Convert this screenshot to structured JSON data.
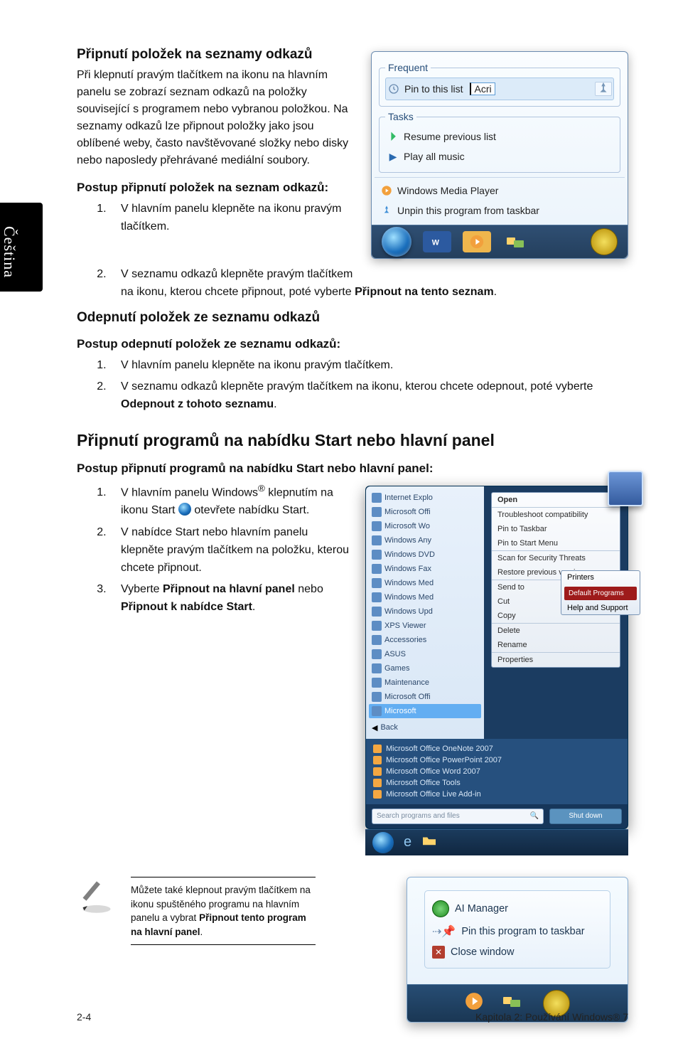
{
  "side_tab": "Čeština",
  "section1": {
    "title": "Připnutí položek na seznamy odkazů",
    "body": "Při klepnutí pravým tlačítkem na ikonu na hlavním panelu se zobrazí seznam odkazů na položky související s programem nebo vybranou položkou. Na seznamy odkazů lze připnout položky jako jsou oblíbené weby, často navštěvované složky nebo disky nebo naposledy přehrávané mediální soubory.",
    "sub": "Postup připnutí položek na seznam odkazů:",
    "steps": [
      "V hlavním panelu klepněte na ikonu pravým tlačítkem.",
      "V seznamu odkazů klepněte pravým tlačítkem na ikonu, kterou chcete připnout, poté vyberte <b>Připnout na tento seznam</b>."
    ]
  },
  "section2": {
    "title": "Odepnutí položek ze seznamu odkazů",
    "sub": "Postup odepnutí položek ze seznamu odkazů:",
    "steps": [
      "V hlavním panelu klepněte na ikonu pravým tlačítkem.",
      "V seznamu odkazů klepněte pravým tlačítkem na ikonu, kterou chcete odepnout, poté vyberte <b>Odepnout z tohoto seznamu</b>."
    ]
  },
  "section3": {
    "title": "Připnutí programů na nabídku Start nebo hlavní panel",
    "sub": "Postup připnutí programů na nabídku Start nebo hlavní panel:",
    "steps": [
      "V hlavním panelu Windows<sup>®</sup> klepnutím na ikonu Start __ORB__ otevřete nabídku Start.",
      "V nabídce Start nebo hlavním panelu klepněte pravým tlačítkem na položku, kterou chcete připnout.",
      "Vyberte <b>Připnout na hlavní panel</b> nebo <b>Připnout k nabídce Start</b>."
    ]
  },
  "note": "Můžete také klepnout pravým tlačítkem na ikonu spuštěného programu na hlavním panelu a vybrat <b>Připnout tento program na hlavní panel</b>.",
  "jump": {
    "frequent": "Frequent",
    "pin_row": "Pin to this list",
    "pin_target": "Acri",
    "tasks": "Tasks",
    "resume": "Resume previous list",
    "play_all": "Play all music",
    "wmp": "Windows Media Player",
    "unpin": "Unpin this program from taskbar"
  },
  "startmenu": {
    "left": [
      "Internet Explo",
      "Microsoft Offi",
      "Microsoft Wo",
      "Windows Any",
      "Windows DVD",
      "Windows Fax",
      "Windows Med",
      "Windows Med",
      "Windows Upd",
      "XPS Viewer",
      "Accessories",
      "ASUS",
      "Games",
      "Maintenance",
      "Microsoft Offi",
      "Microsoft"
    ],
    "ctx_top": "Open",
    "ctx": [
      "Troubleshoot compatibility",
      "Pin to Taskbar",
      "Pin to Start Menu",
      "Scan for Security Threats",
      "Restore previous versions",
      "Send to",
      "Cut",
      "Copy",
      "Delete",
      "Rename",
      "Properties"
    ],
    "mid": [
      "Microsoft Office OneNote 2007",
      "Microsoft Office PowerPoint 2007",
      "Microsoft Office Word 2007",
      "Microsoft Office Tools",
      "Microsoft Office Live Add-in"
    ],
    "back": "Back",
    "search_ph": "Search programs and files",
    "drop": [
      "Printers",
      "Default Programs",
      "Help and Support"
    ],
    "shut": "Shut down"
  },
  "pinpanel": {
    "ai": "AI Manager",
    "pin": "Pin this program to taskbar",
    "close": "Close window"
  },
  "footer": {
    "left": "2-4",
    "right": "Kapitola 2: Používání Windows® 7"
  }
}
